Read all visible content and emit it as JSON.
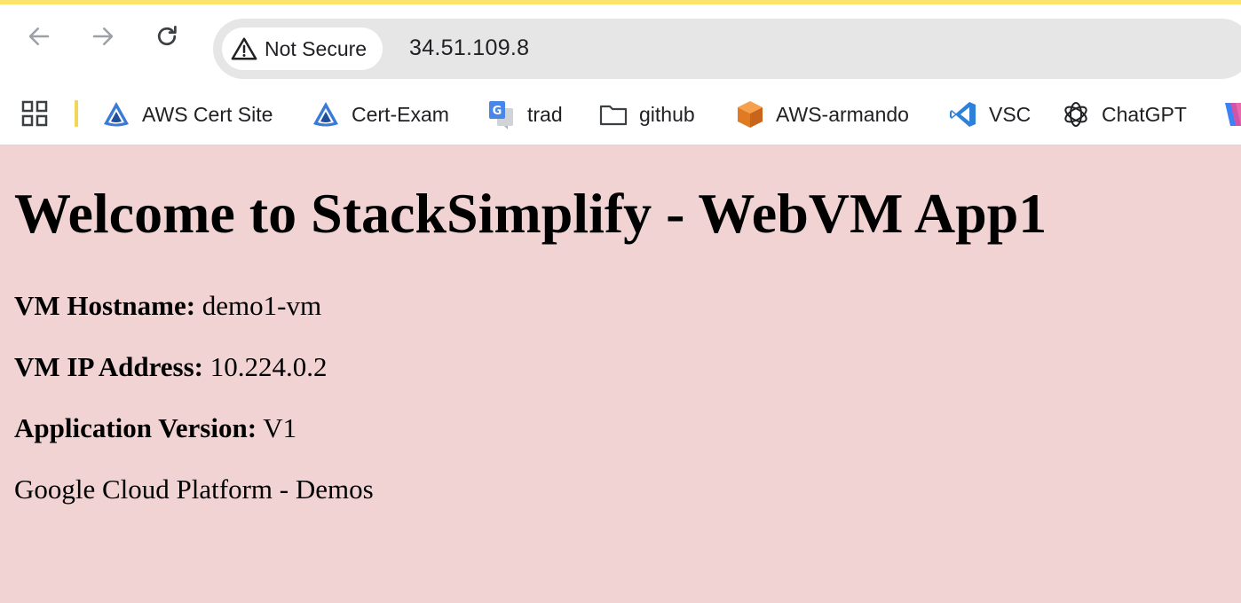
{
  "browser": {
    "security_label": "Not Secure",
    "url": "34.51.109.8",
    "accent_color": "#fbe36c"
  },
  "bookmarks": [
    {
      "label": "AWS Cert Site",
      "icon": "aws-cert-site-icon"
    },
    {
      "label": "Cert-Exam",
      "icon": "cert-exam-icon"
    },
    {
      "label": "trad",
      "icon": "google-translate-icon"
    },
    {
      "label": "github",
      "icon": "folder-icon"
    },
    {
      "label": "AWS-armando",
      "icon": "aws-cube-icon"
    },
    {
      "label": "VSC",
      "icon": "vscode-icon"
    },
    {
      "label": "ChatGPT",
      "icon": "chatgpt-icon"
    }
  ],
  "page": {
    "title": "Welcome to StackSimplify - WebVM App1",
    "hostname_label": "VM Hostname:",
    "hostname_value": "demo1-vm",
    "ip_label": "VM IP Address:",
    "ip_value": "10.224.0.2",
    "version_label": "Application Version:",
    "version_value": "V1",
    "footer_text": "Google Cloud Platform - Demos",
    "background_color": "#f2d3d3"
  }
}
